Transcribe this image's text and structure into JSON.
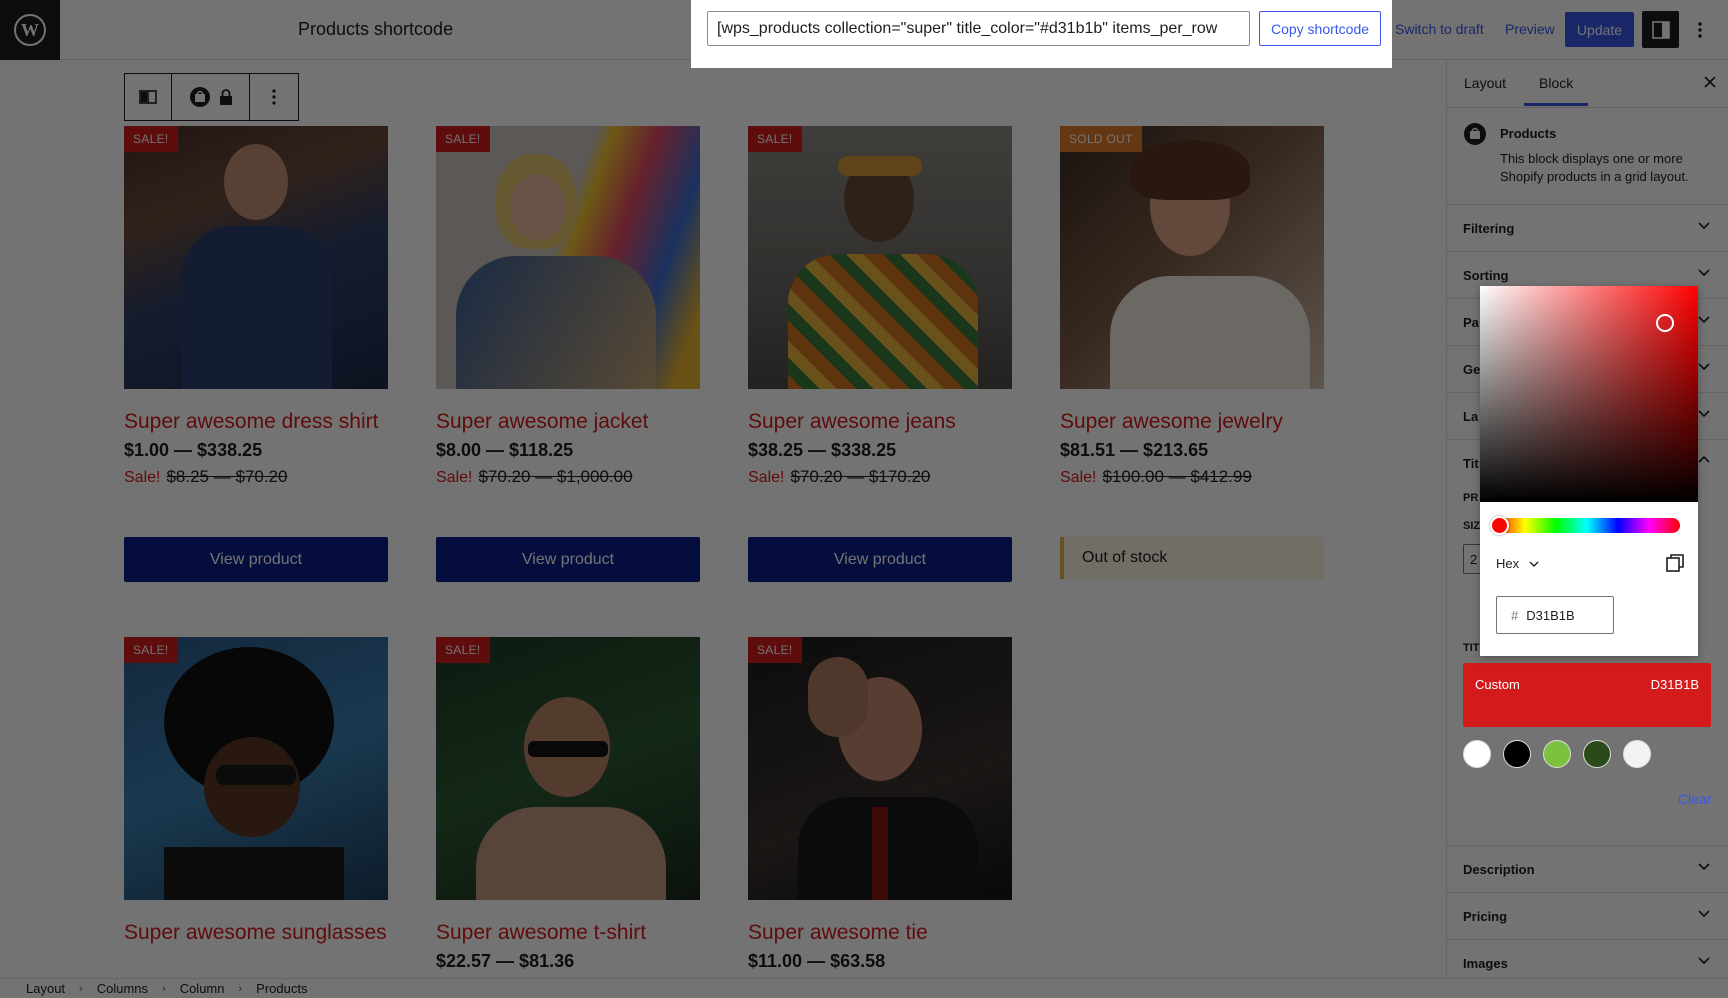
{
  "header": {
    "title": "Products shortcode",
    "switch_to_draft": "Switch to draft",
    "preview": "Preview",
    "update": "Update"
  },
  "shortcode": {
    "value": "[wps_products collection=\"super\" title_color=\"#d31b1b\" items_per_row",
    "copy_label": "Copy shortcode"
  },
  "products": [
    {
      "title": "Super awesome dress shirt",
      "badge": "SALE!",
      "price": "$1.00 — $338.25",
      "sale_label": "Sale!",
      "old_price": "$8.25 — $70.20",
      "action": "View product"
    },
    {
      "title": "Super awesome jacket",
      "badge": "SALE!",
      "price": "$8.00 — $118.25",
      "sale_label": "Sale!",
      "old_price": "$70.20 — $1,000.00",
      "action": "View product"
    },
    {
      "title": "Super awesome jeans",
      "badge": "SALE!",
      "price": "$38.25 — $338.25",
      "sale_label": "Sale!",
      "old_price": "$70.20 — $170.20",
      "action": "View product"
    },
    {
      "title": "Super awesome jewelry",
      "badge": "SOLD OUT",
      "price": "$81.51 — $213.65",
      "sale_label": "Sale!",
      "old_price": "$100.00 — $412.99",
      "action": "Out of stock"
    },
    {
      "title": "Super awesome sunglasses",
      "badge": "SALE!"
    },
    {
      "title": "Super awesome t-shirt",
      "badge": "SALE!",
      "price": "$22.57 — $81.36"
    },
    {
      "title": "Super awesome tie",
      "badge": "SALE!",
      "price": "$11.00 — $63.58"
    }
  ],
  "sidebar": {
    "tabs": [
      "Layout",
      "Block"
    ],
    "block_name": "Products",
    "block_desc": "This block displays one or more Shopify products in a grid layout.",
    "panels": [
      "Filtering",
      "Sorting",
      "Pa",
      "Ge",
      "La",
      "Tit"
    ],
    "bottom_panels": [
      "Description",
      "Pricing",
      "Images"
    ],
    "clipped_labels": [
      "PR",
      "SIZ",
      "2",
      "TIT"
    ]
  },
  "color_picker": {
    "format": "Hex",
    "hex_value": "D31B1B",
    "custom_label": "Custom",
    "custom_value": "D31B1B",
    "swatches": [
      "#ffffff",
      "#000000",
      "#7cc23f",
      "#2b4a1a",
      "#f2f2f2"
    ],
    "clear_label": "Clear"
  },
  "breadcrumb": [
    "Layout",
    "Columns",
    "Column",
    "Products"
  ],
  "colors": {
    "accent": "#3858e9",
    "title": "#d31b1b",
    "button": "#0b1e8a"
  }
}
